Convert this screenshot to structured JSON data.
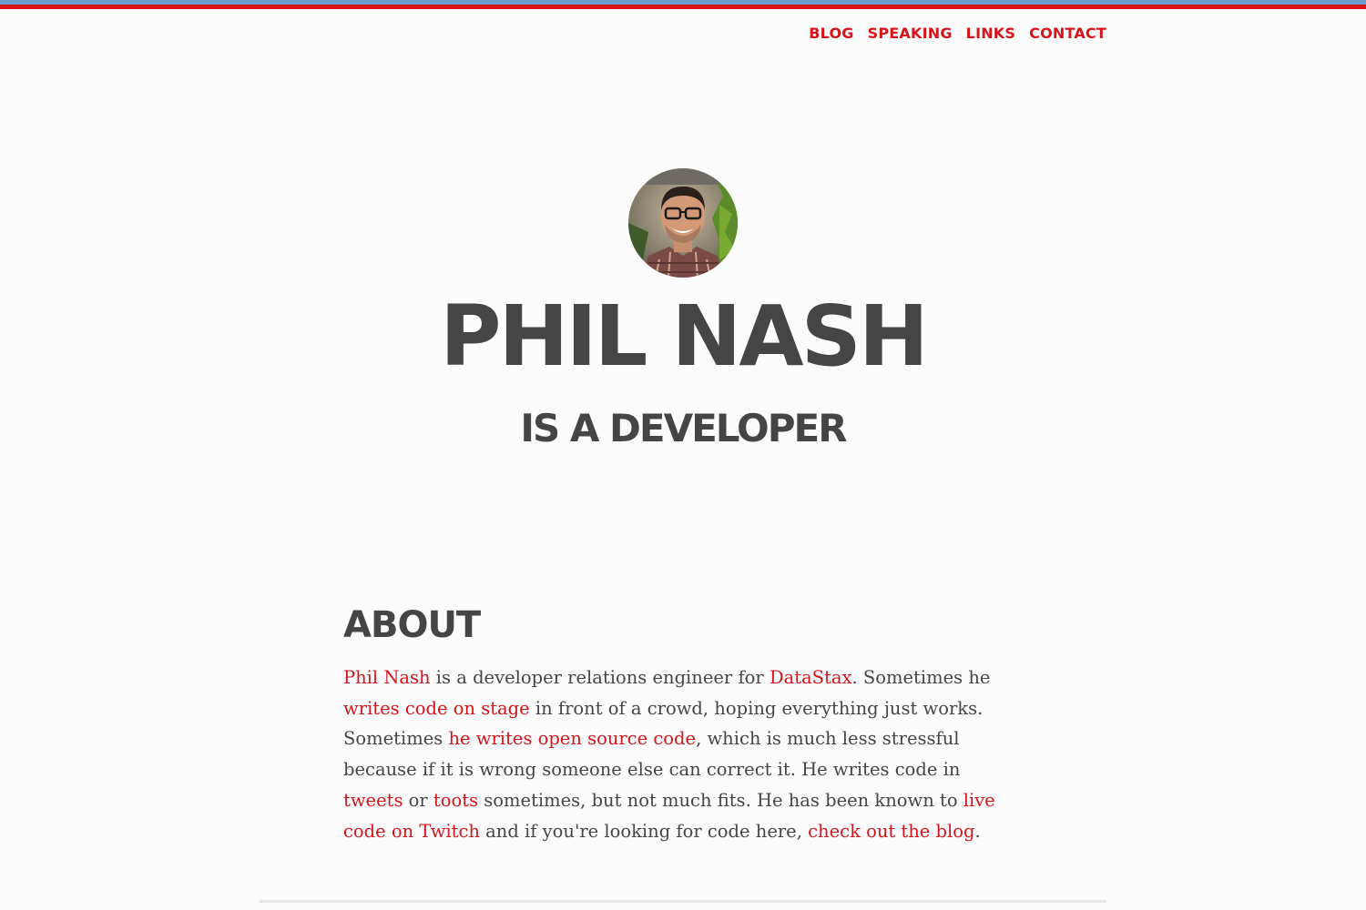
{
  "colors": {
    "accent": "#d8141b",
    "stripe_top": "#6a9fcf",
    "text": "#454545",
    "background": "#fcfcfc"
  },
  "nav": [
    {
      "label": "BLOG"
    },
    {
      "label": "SPEAKING"
    },
    {
      "label": "LINKS"
    },
    {
      "label": "CONTACT"
    }
  ],
  "hero": {
    "avatar_icon": "profile-photo",
    "name": "PHIL NASH",
    "tagline": "IS A DEVELOPER"
  },
  "about": {
    "heading": "ABOUT",
    "link_phil_nash": "Phil Nash",
    "text_1": " is a developer relations engineer for ",
    "link_datastax": "DataStax",
    "text_2": ". Sometimes he ",
    "link_writes_code_on_stage": "writes code on stage",
    "text_3": " in front of a crowd, hoping everything just works. Sometimes ",
    "link_open_source": "he writes open source code",
    "text_4": ", which is much less stressful because if it is wrong someone else can correct it. He writes code in ",
    "link_tweets": "tweets",
    "text_5": " or ",
    "link_toots": "toots",
    "text_6": " sometimes, but not much fits. He has been known to ",
    "link_twitch": "live code on Twitch",
    "text_7": " and if you're looking for code here, ",
    "link_blog": "check out the blog",
    "text_8": "."
  }
}
